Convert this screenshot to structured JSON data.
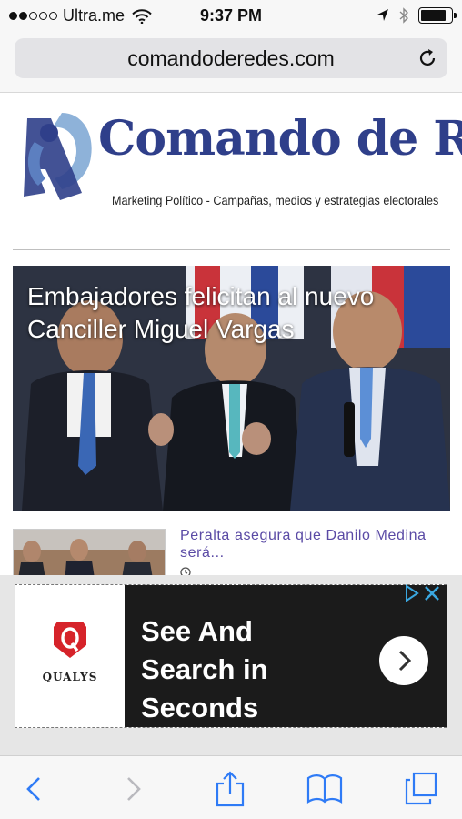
{
  "status_bar": {
    "carrier": "Ultra.me",
    "time": "9:37 PM",
    "signal_bars_filled": 2,
    "signal_bars_total": 5,
    "battery_level": 0.85
  },
  "browser": {
    "url": "comandoderedes.com"
  },
  "site": {
    "logo_title": "Comando de Redes",
    "logo_tagline": "Marketing Político - Campañas, medios y estrategias electorales"
  },
  "hero": {
    "title": "Embajadores felicitan al nuevo Canciller Miguel Vargas"
  },
  "article": {
    "title": "Peralta asegura que Danilo Medina será..."
  },
  "ad": {
    "brand": "QUALYS",
    "headline": "See And Search in Seconds"
  },
  "toolbar": {
    "icons": [
      "back-icon",
      "forward-icon",
      "share-icon",
      "bookmarks-icon",
      "tabs-icon"
    ]
  },
  "colors": {
    "link": "#5a4aa5",
    "logo_blue": "#2f3f8a",
    "ios_blue": "#2f7bf6",
    "ad_red": "#d6232a"
  }
}
